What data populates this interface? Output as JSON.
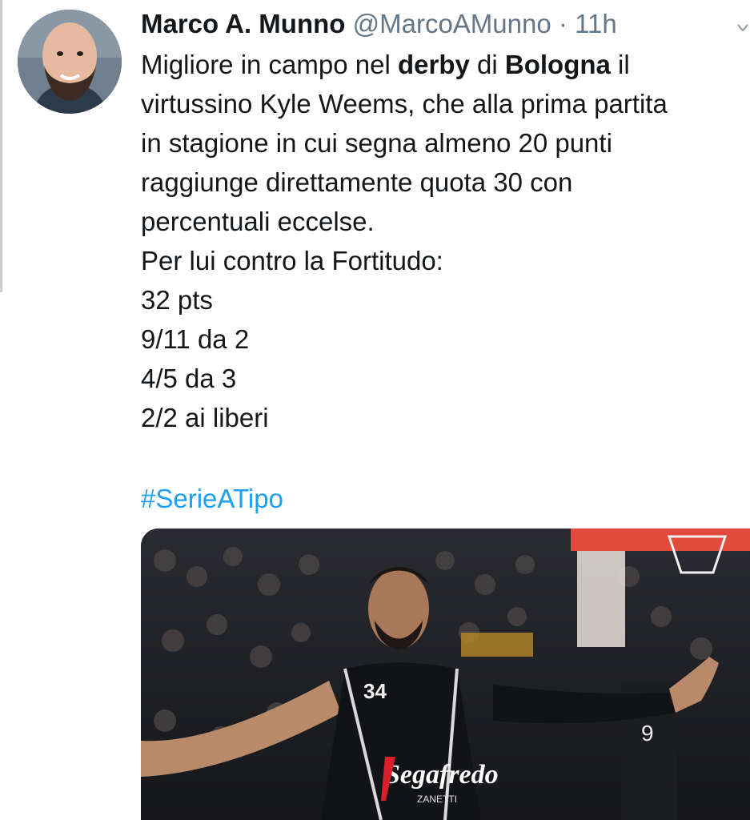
{
  "tweet": {
    "author_name": "Marco A. Munno",
    "author_handle": "@MarcoAMunno",
    "separator": "·",
    "time_ago": "11h",
    "text_lines": [
      [
        "Migliore in campo nel ",
        "derby",
        " di ",
        "Bologna",
        " il"
      ],
      [
        "virtussino Kyle Weems, che alla prima partita"
      ],
      [
        "in stagione in cui segna almeno 20 punti"
      ],
      [
        "raggiunge direttamente quota 30 con"
      ],
      [
        "percentuali eccelse."
      ],
      [
        "Per lui contro la Fortitudo:"
      ],
      [
        "32 pts"
      ],
      [
        "9/11 da 2"
      ],
      [
        "4/5 da 3"
      ],
      [
        "2/2 ai liberi"
      ]
    ],
    "hashtag": "#SerieATipo",
    "media": {
      "jersey_number": "34",
      "teammate_number": "9",
      "sponsor": "Segafredo",
      "sponsor_sub": "ZANETTI"
    }
  },
  "icons": {
    "avatar": "profile-photo",
    "caret": "chevron-down-icon"
  },
  "colors": {
    "name": "#14171a",
    "secondary": "#657786",
    "link": "#1da1f2",
    "sponsor_red": "#d6202b"
  }
}
